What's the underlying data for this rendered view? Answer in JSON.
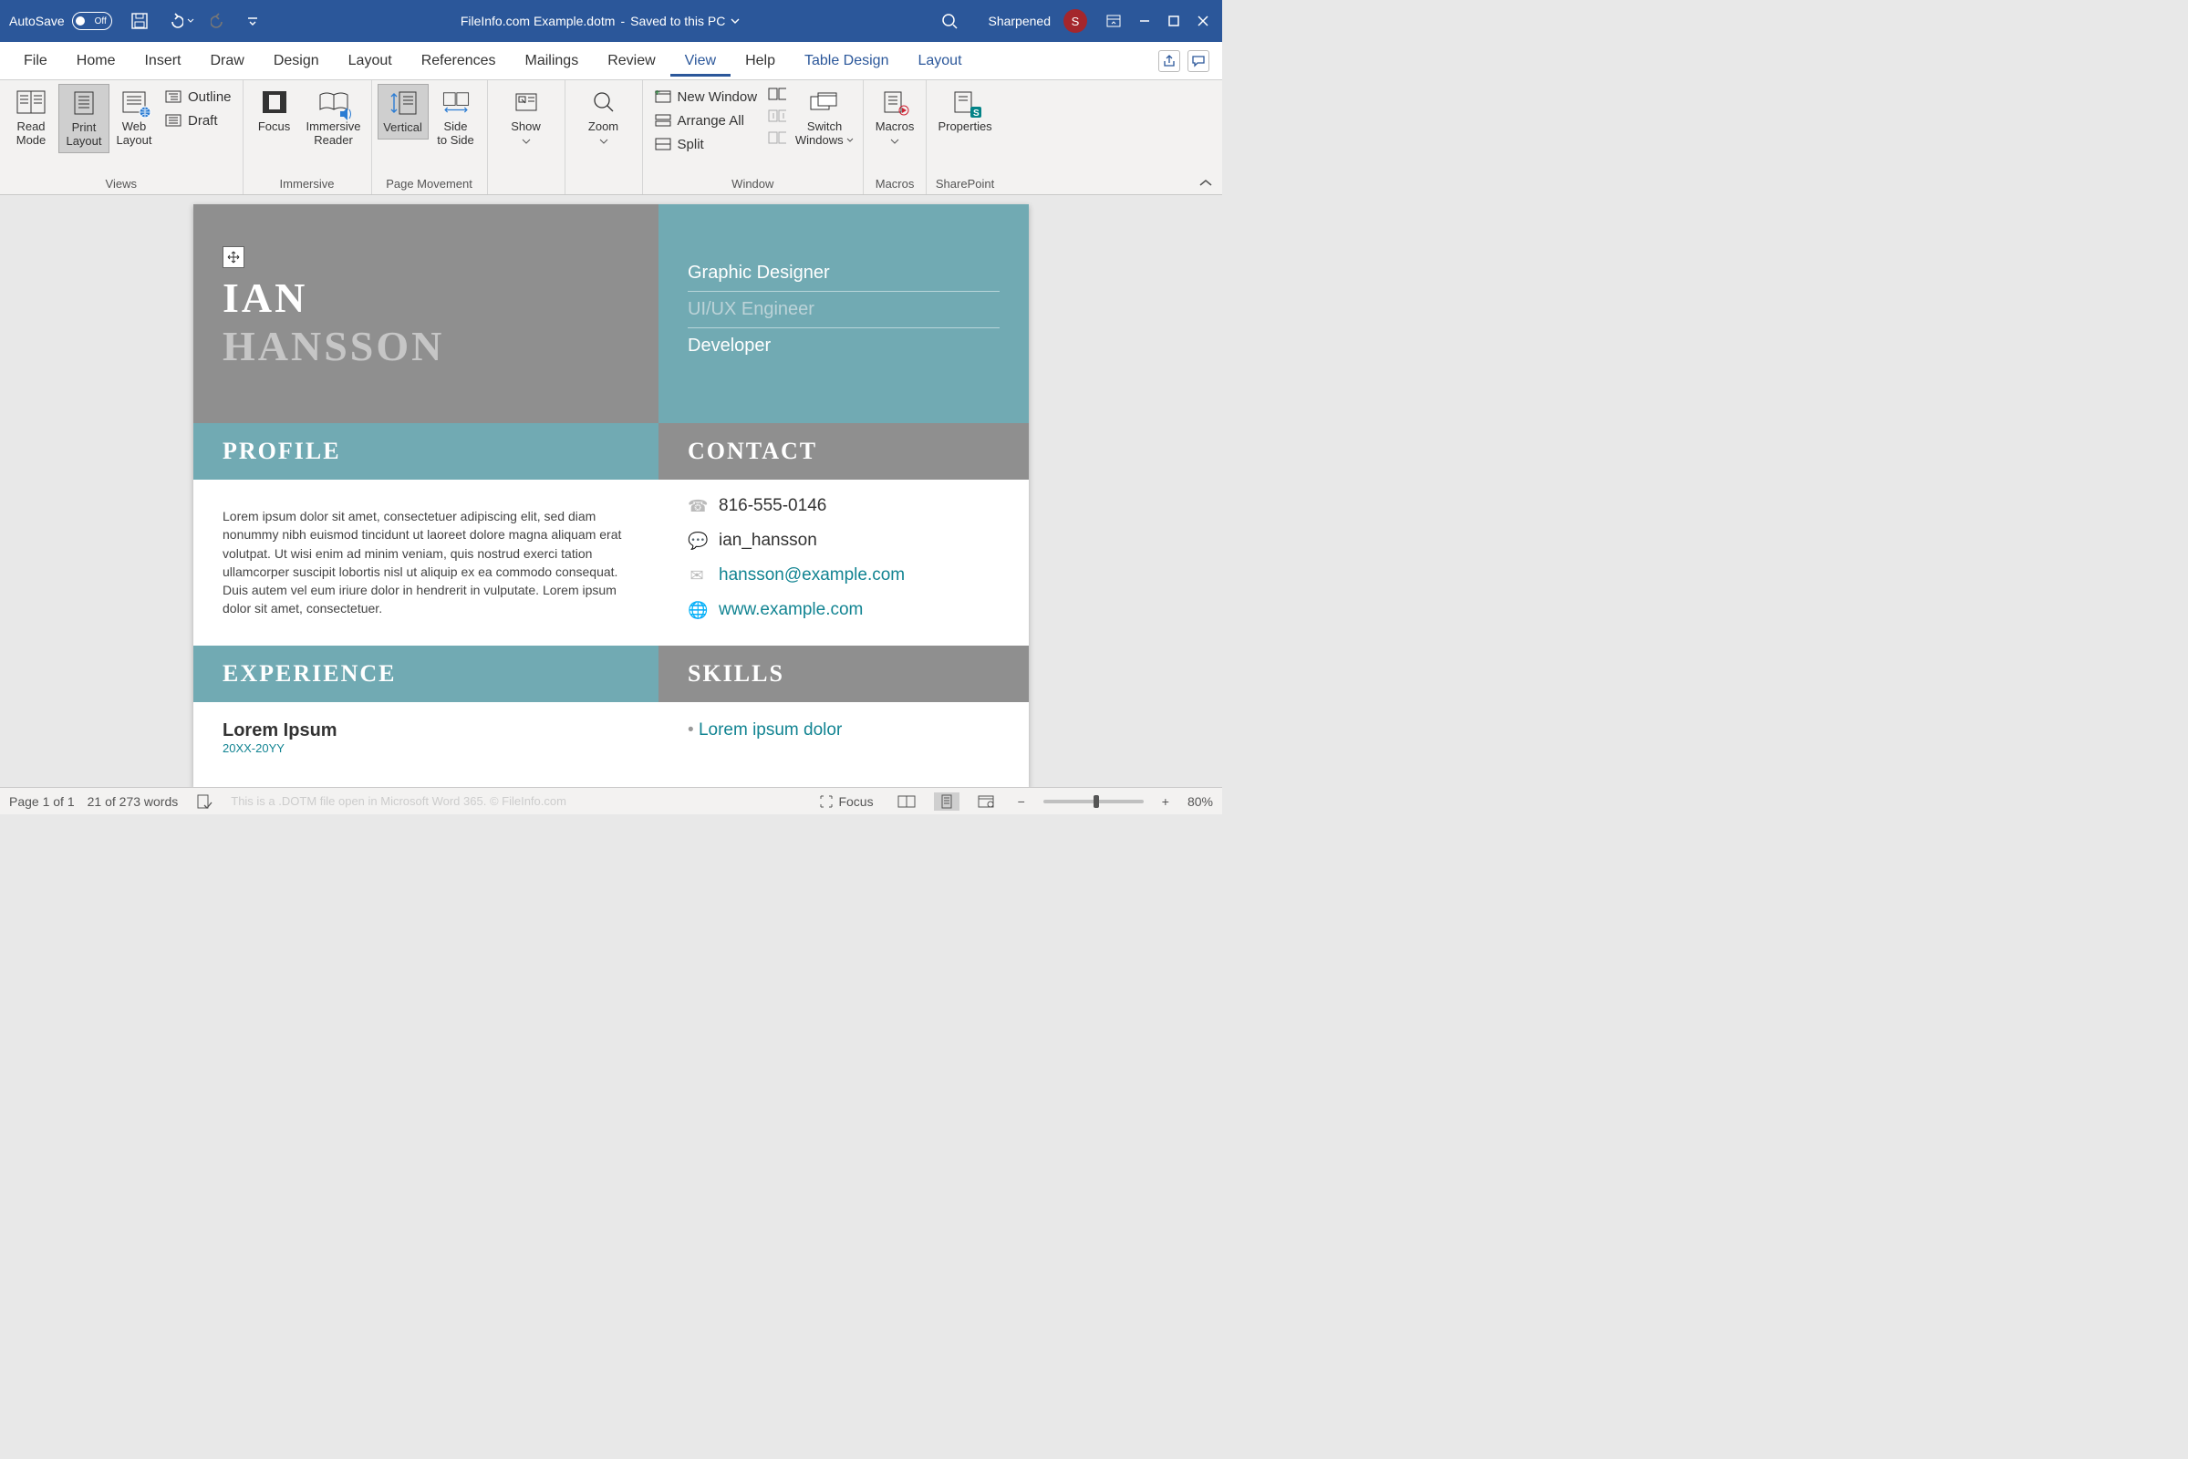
{
  "titlebar": {
    "autosave_label": "AutoSave",
    "autosave_state": "Off",
    "doc_title": "FileInfo.com Example.dotm",
    "save_status": "Saved to this PC",
    "user_name": "Sharpened",
    "user_initial": "S"
  },
  "tabs": [
    "File",
    "Home",
    "Insert",
    "Draw",
    "Design",
    "Layout",
    "References",
    "Mailings",
    "Review",
    "View",
    "Help",
    "Table Design",
    "Layout"
  ],
  "active_tab": "View",
  "ribbon": {
    "group1": {
      "label": "Views",
      "read_mode": "Read\nMode",
      "print_layout": "Print\nLayout",
      "web_layout": "Web\nLayout",
      "outline": "Outline",
      "draft": "Draft"
    },
    "group2": {
      "label": "Immersive",
      "focus": "Focus",
      "immersive": "Immersive\nReader"
    },
    "group3": {
      "label": "Page Movement",
      "vertical": "Vertical",
      "side": "Side\nto Side"
    },
    "show": {
      "label": "Show"
    },
    "zoom": {
      "label": "Zoom"
    },
    "window": {
      "label": "Window",
      "new": "New Window",
      "arrange": "Arrange All",
      "split": "Split",
      "switch": "Switch\nWindows"
    },
    "macros": {
      "label": "Macros",
      "btn": "Macros"
    },
    "sharepoint": {
      "label": "SharePoint",
      "btn": "Properties"
    }
  },
  "doc": {
    "first": "IAN",
    "last": "HANSSON",
    "roles": [
      "Graphic Designer",
      "UI/UX Engineer",
      "Developer"
    ],
    "profile_h": "PROFILE",
    "contact_h": "CONTACT",
    "experience_h": "EXPERIENCE",
    "skills_h": "SKILLS",
    "profile_text": "Lorem ipsum dolor sit amet, consectetuer adipiscing elit, sed diam nonummy nibh euismod tincidunt ut laoreet dolore magna aliquam erat volutpat. Ut wisi enim ad minim veniam, quis nostrud exerci tation ullamcorper suscipit lobortis nisl ut aliquip ex ea commodo consequat. Duis autem vel eum iriure dolor in hendrerit in vulputate. Lorem ipsum dolor sit amet, consectetuer.",
    "phone": "816-555-0146",
    "chat": "ian_hansson",
    "email": "hansson@example.com",
    "web": "www.example.com",
    "exp_title": "Lorem Ipsum",
    "exp_dates": "20XX-20YY",
    "skill1": "Lorem ipsum dolor"
  },
  "statusbar": {
    "page": "Page 1 of 1",
    "words": "21 of 273 words",
    "footer_note": "This is a .DOTM file open in Microsoft Word 365. © FileInfo.com",
    "focus": "Focus",
    "zoom": "80%"
  }
}
